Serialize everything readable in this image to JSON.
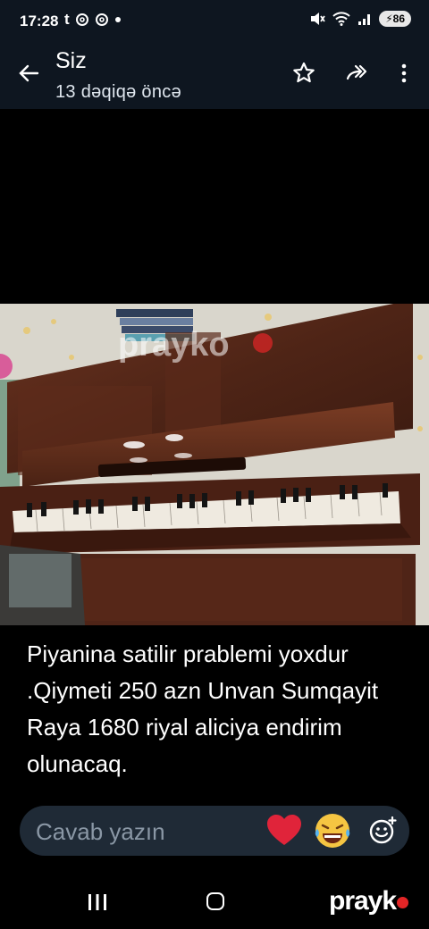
{
  "status_bar": {
    "time": "17:28",
    "app_letter": "t",
    "battery": "86"
  },
  "header": {
    "title": "Siz",
    "subtitle": "13 dəqiqə öncə",
    "icons": [
      "back-arrow-icon",
      "star-icon",
      "forward-icon",
      "more-vertical-icon"
    ]
  },
  "photo": {
    "watermark": "prayko"
  },
  "message": {
    "text": "Piyanina satilir prablemi yoxdur .Qiymeti 250 azn Unvan Sumqayit Raya 1680 riyal aliciya endirim olunacaq."
  },
  "reply": {
    "placeholder": "Cavab yazın"
  },
  "footer": {
    "brand": "prayk"
  },
  "colors": {
    "bar_bg": "#0e1620",
    "input_bg": "#1f2a36",
    "brand_red": "#e32526"
  }
}
